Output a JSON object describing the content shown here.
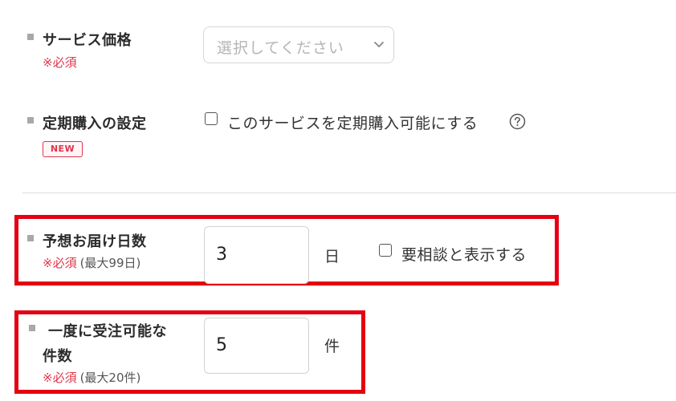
{
  "service_price": {
    "label": "サービス価格",
    "required": "※必須",
    "select_placeholder": "選択してください"
  },
  "subscription": {
    "label": "定期購入の設定",
    "badge": "NEW",
    "checkbox_label": "このサービスを定期購入可能にする",
    "checked": false
  },
  "delivery_days": {
    "label": "予想お届け日数",
    "required": "※必須",
    "note": "(最大99日)",
    "value": "3",
    "unit": "日",
    "checkbox_label": "要相談と表示する",
    "checked": false
  },
  "max_orders": {
    "label_line1": "一度に受注可能な",
    "label_line2": "件数",
    "required": "※必須",
    "note": "(最大20件)",
    "value": "5",
    "unit": "件"
  },
  "colors": {
    "required_red": "#e0354a",
    "highlight_red": "#e50012",
    "bullet_gray": "#a8a8a8"
  }
}
